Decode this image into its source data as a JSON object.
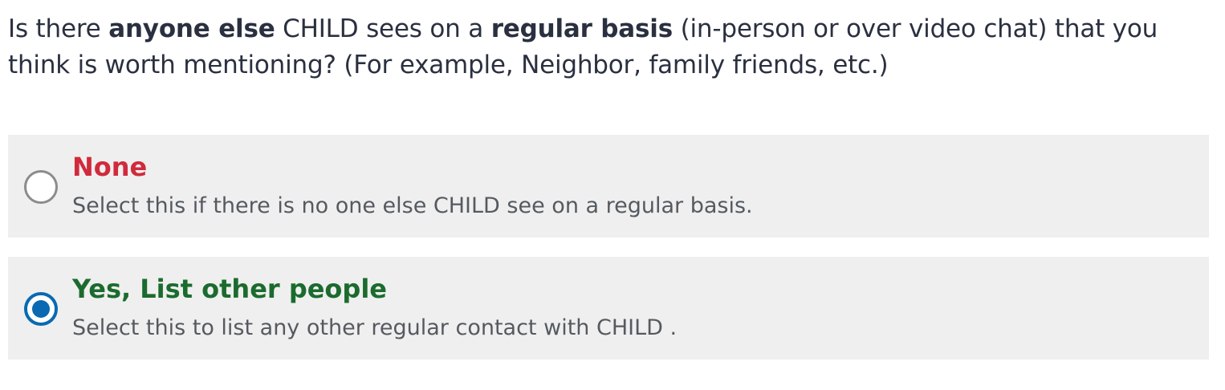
{
  "question": {
    "part1": "Is there ",
    "bold1": "anyone else",
    "part2": " CHILD sees on a ",
    "bold2": "regular basis",
    "part3": " (in-person or over video chat) that you think is worth mentioning? (For example, Neighbor, family friends, etc.)"
  },
  "options": [
    {
      "title": "None",
      "description": "Select this if there is no one else CHILD see on a regular basis.",
      "selected": false,
      "title_color": "#d12a3c"
    },
    {
      "title": "Yes, List other people",
      "description": "Select this to list any other regular contact with CHILD .",
      "selected": true,
      "title_color": "#1b6b2e"
    }
  ],
  "colors": {
    "radio_selected": "#0a69b2",
    "radio_unselected": "#8c8c8c",
    "option_background": "#efefef",
    "text": "#2a3040"
  }
}
